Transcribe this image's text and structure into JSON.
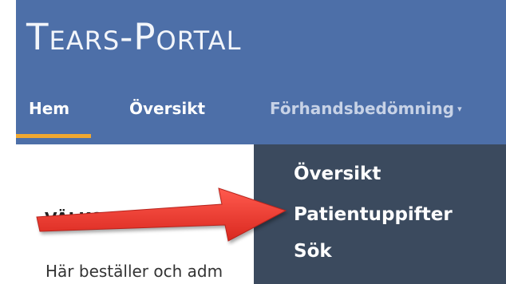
{
  "header": {
    "brand": "Tears-Portal"
  },
  "nav": {
    "home": "Hem",
    "overview": "Översikt",
    "assessment": "Förhandsbedömning",
    "caret": "▾"
  },
  "dropdown": {
    "items": [
      {
        "label": "Översikt"
      },
      {
        "label": "Patientuppifter"
      },
      {
        "label": "Sök"
      }
    ]
  },
  "content": {
    "welcome": "Välkommen till",
    "intro": "Här beställer och adm"
  },
  "colors": {
    "header_bg": "#4d6fa8",
    "dropdown_bg": "#3b4a5e",
    "active_underline": "#f0a830",
    "annotation_arrow": "#e8372f"
  }
}
